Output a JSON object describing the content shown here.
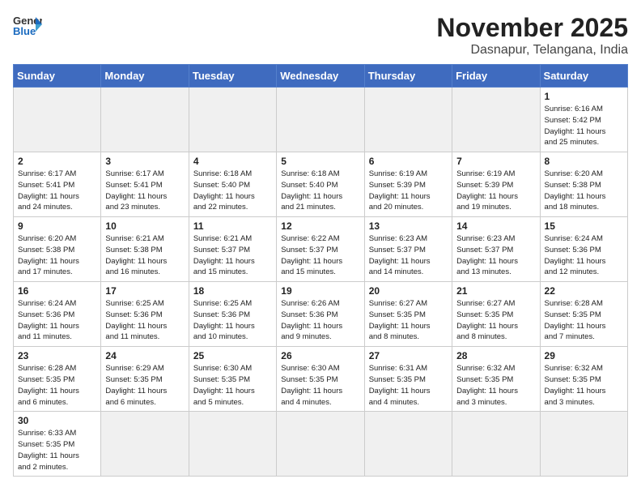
{
  "header": {
    "logo_general": "General",
    "logo_blue": "Blue",
    "month_title": "November 2025",
    "location": "Dasnapur, Telangana, India"
  },
  "weekdays": [
    "Sunday",
    "Monday",
    "Tuesday",
    "Wednesday",
    "Thursday",
    "Friday",
    "Saturday"
  ],
  "weeks": [
    [
      {
        "day": "",
        "info": ""
      },
      {
        "day": "",
        "info": ""
      },
      {
        "day": "",
        "info": ""
      },
      {
        "day": "",
        "info": ""
      },
      {
        "day": "",
        "info": ""
      },
      {
        "day": "",
        "info": ""
      },
      {
        "day": "1",
        "info": "Sunrise: 6:16 AM\nSunset: 5:42 PM\nDaylight: 11 hours\nand 25 minutes."
      }
    ],
    [
      {
        "day": "2",
        "info": "Sunrise: 6:17 AM\nSunset: 5:41 PM\nDaylight: 11 hours\nand 24 minutes."
      },
      {
        "day": "3",
        "info": "Sunrise: 6:17 AM\nSunset: 5:41 PM\nDaylight: 11 hours\nand 23 minutes."
      },
      {
        "day": "4",
        "info": "Sunrise: 6:18 AM\nSunset: 5:40 PM\nDaylight: 11 hours\nand 22 minutes."
      },
      {
        "day": "5",
        "info": "Sunrise: 6:18 AM\nSunset: 5:40 PM\nDaylight: 11 hours\nand 21 minutes."
      },
      {
        "day": "6",
        "info": "Sunrise: 6:19 AM\nSunset: 5:39 PM\nDaylight: 11 hours\nand 20 minutes."
      },
      {
        "day": "7",
        "info": "Sunrise: 6:19 AM\nSunset: 5:39 PM\nDaylight: 11 hours\nand 19 minutes."
      },
      {
        "day": "8",
        "info": "Sunrise: 6:20 AM\nSunset: 5:38 PM\nDaylight: 11 hours\nand 18 minutes."
      }
    ],
    [
      {
        "day": "9",
        "info": "Sunrise: 6:20 AM\nSunset: 5:38 PM\nDaylight: 11 hours\nand 17 minutes."
      },
      {
        "day": "10",
        "info": "Sunrise: 6:21 AM\nSunset: 5:38 PM\nDaylight: 11 hours\nand 16 minutes."
      },
      {
        "day": "11",
        "info": "Sunrise: 6:21 AM\nSunset: 5:37 PM\nDaylight: 11 hours\nand 15 minutes."
      },
      {
        "day": "12",
        "info": "Sunrise: 6:22 AM\nSunset: 5:37 PM\nDaylight: 11 hours\nand 15 minutes."
      },
      {
        "day": "13",
        "info": "Sunrise: 6:23 AM\nSunset: 5:37 PM\nDaylight: 11 hours\nand 14 minutes."
      },
      {
        "day": "14",
        "info": "Sunrise: 6:23 AM\nSunset: 5:37 PM\nDaylight: 11 hours\nand 13 minutes."
      },
      {
        "day": "15",
        "info": "Sunrise: 6:24 AM\nSunset: 5:36 PM\nDaylight: 11 hours\nand 12 minutes."
      }
    ],
    [
      {
        "day": "16",
        "info": "Sunrise: 6:24 AM\nSunset: 5:36 PM\nDaylight: 11 hours\nand 11 minutes."
      },
      {
        "day": "17",
        "info": "Sunrise: 6:25 AM\nSunset: 5:36 PM\nDaylight: 11 hours\nand 11 minutes."
      },
      {
        "day": "18",
        "info": "Sunrise: 6:25 AM\nSunset: 5:36 PM\nDaylight: 11 hours\nand 10 minutes."
      },
      {
        "day": "19",
        "info": "Sunrise: 6:26 AM\nSunset: 5:36 PM\nDaylight: 11 hours\nand 9 minutes."
      },
      {
        "day": "20",
        "info": "Sunrise: 6:27 AM\nSunset: 5:35 PM\nDaylight: 11 hours\nand 8 minutes."
      },
      {
        "day": "21",
        "info": "Sunrise: 6:27 AM\nSunset: 5:35 PM\nDaylight: 11 hours\nand 8 minutes."
      },
      {
        "day": "22",
        "info": "Sunrise: 6:28 AM\nSunset: 5:35 PM\nDaylight: 11 hours\nand 7 minutes."
      }
    ],
    [
      {
        "day": "23",
        "info": "Sunrise: 6:28 AM\nSunset: 5:35 PM\nDaylight: 11 hours\nand 6 minutes."
      },
      {
        "day": "24",
        "info": "Sunrise: 6:29 AM\nSunset: 5:35 PM\nDaylight: 11 hours\nand 6 minutes."
      },
      {
        "day": "25",
        "info": "Sunrise: 6:30 AM\nSunset: 5:35 PM\nDaylight: 11 hours\nand 5 minutes."
      },
      {
        "day": "26",
        "info": "Sunrise: 6:30 AM\nSunset: 5:35 PM\nDaylight: 11 hours\nand 4 minutes."
      },
      {
        "day": "27",
        "info": "Sunrise: 6:31 AM\nSunset: 5:35 PM\nDaylight: 11 hours\nand 4 minutes."
      },
      {
        "day": "28",
        "info": "Sunrise: 6:32 AM\nSunset: 5:35 PM\nDaylight: 11 hours\nand 3 minutes."
      },
      {
        "day": "29",
        "info": "Sunrise: 6:32 AM\nSunset: 5:35 PM\nDaylight: 11 hours\nand 3 minutes."
      }
    ],
    [
      {
        "day": "30",
        "info": "Sunrise: 6:33 AM\nSunset: 5:35 PM\nDaylight: 11 hours\nand 2 minutes."
      },
      {
        "day": "",
        "info": ""
      },
      {
        "day": "",
        "info": ""
      },
      {
        "day": "",
        "info": ""
      },
      {
        "day": "",
        "info": ""
      },
      {
        "day": "",
        "info": ""
      },
      {
        "day": "",
        "info": ""
      }
    ]
  ]
}
